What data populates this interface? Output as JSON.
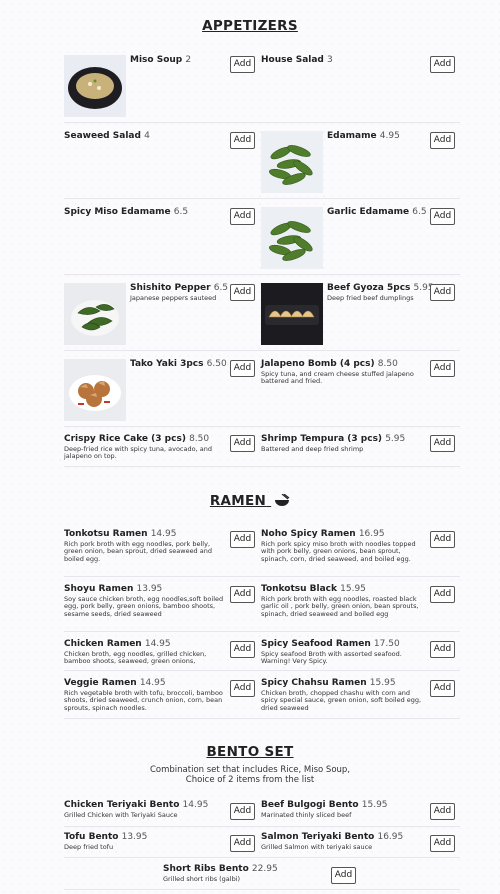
{
  "sections": {
    "appetizers": "APPETIZERS",
    "ramen": "RAMEN",
    "bento": "BENTO SET",
    "bento_desc": "Combination set that includes Rice, Miso Soup, Choice of 2 items from the list"
  },
  "add_label": "Add",
  "ramen_icon": "ramen-bowl-icon",
  "appetizers": [
    {
      "name": "Miso Soup",
      "price": "2",
      "desc": "",
      "image": "miso-soup"
    },
    {
      "name": "House Salad",
      "price": "3",
      "desc": "",
      "image": ""
    },
    {
      "name": "Seaweed Salad",
      "price": "4",
      "desc": "",
      "image": ""
    },
    {
      "name": "Edamame",
      "price": "4.95",
      "desc": "",
      "image": "edamame"
    },
    {
      "name": "Spicy Miso Edamame",
      "price": "6.5",
      "desc": "",
      "image": ""
    },
    {
      "name": "Garlic Edamame",
      "price": "6.5",
      "desc": "",
      "image": "edamame"
    },
    {
      "name": "Shishito Pepper",
      "price": "6.5",
      "desc": "Japanese peppers sauteed",
      "image": "peppers"
    },
    {
      "name": "Beef Gyoza 5pcs",
      "price": "5.95",
      "desc": "Deep fried beef dumplings",
      "image": "gyoza"
    },
    {
      "name": "Tako Yaki 3pcs",
      "price": "6.50",
      "desc": "",
      "image": "takoyaki"
    },
    {
      "name": "Jalapeno Bomb (4 pcs)",
      "price": "8.50",
      "desc": "Spicy tuna, and cream cheese stuffed jalapeno battered and fried.",
      "image": ""
    },
    {
      "name": "Crispy Rice Cake (3 pcs)",
      "price": "8.50",
      "desc": "Deep-fried rice with spicy tuna, avocado, and jalapeno on top.",
      "image": ""
    },
    {
      "name": "Shrimp Tempura (3 pcs)",
      "price": "5.95",
      "desc": "Battered and deep fried shrimp",
      "image": ""
    }
  ],
  "ramen": [
    {
      "name": "Tonkotsu Ramen",
      "price": "14.95",
      "desc": "Rich pork broth with egg noodles, pork belly, green onion, bean sprout, dried seaweed and boiled egg."
    },
    {
      "name": "Noho Spicy Ramen",
      "price": "16.95",
      "desc": "Rich pork spicy miso broth with noodles topped with pork belly, green onions, bean sprout, spinach, corn, dried seaweed, and boiled egg."
    },
    {
      "name": "Shoyu Ramen",
      "price": "13.95",
      "desc": "Soy sauce chicken broth, egg noodles,soft boiled egg, pork belly, green onions, bamboo shoots, sesame seeds, dried seaweed"
    },
    {
      "name": "Tonkotsu Black",
      "price": "15.95",
      "desc": "Rich pork broth with egg noodles, roasted black garlic oil , pork belly, green onion, bean sprouts, spinach, dried seaweed and boiled egg"
    },
    {
      "name": "Chicken Ramen",
      "price": "14.95",
      "desc": "Chicken broth, egg noodles, grilled chicken, bamboo shoots, seaweed, green onions,"
    },
    {
      "name": "Spicy Seafood Ramen",
      "price": "17.50",
      "desc": "Spicy seafood Broth with assorted seafood. Warning! Very Spicy."
    },
    {
      "name": "Veggie Ramen",
      "price": "14.95",
      "desc": "Rich vegetable broth with tofu, broccoli, bamboo shoots, dried seaweed, crunch onion, corn, bean sprouts, spinach noodles."
    },
    {
      "name": "Spicy Chahsu Ramen",
      "price": "15.95",
      "desc": "Chicken broth, chopped chashu with corn and spicy special sauce, green onion, soft boiled egg, dried seaweed"
    }
  ],
  "bento": [
    {
      "name": "Chicken Teriyaki Bento",
      "price": "14.95",
      "desc": "Grilled Chicken with Teriyaki Sauce"
    },
    {
      "name": "Beef Bulgogi Bento",
      "price": "15.95",
      "desc": "Marinated thinly sliced beef"
    },
    {
      "name": "Tofu Bento",
      "price": "13.95",
      "desc": "Deep fried tofu"
    },
    {
      "name": "Salmon Teriyaki Bento",
      "price": "16.95",
      "desc": "Grilled Salmon with teriyaki sauce"
    },
    {
      "name": "Short Ribs Bento",
      "price": "22.95",
      "desc": "Grilled short ribs (galbi)"
    }
  ]
}
